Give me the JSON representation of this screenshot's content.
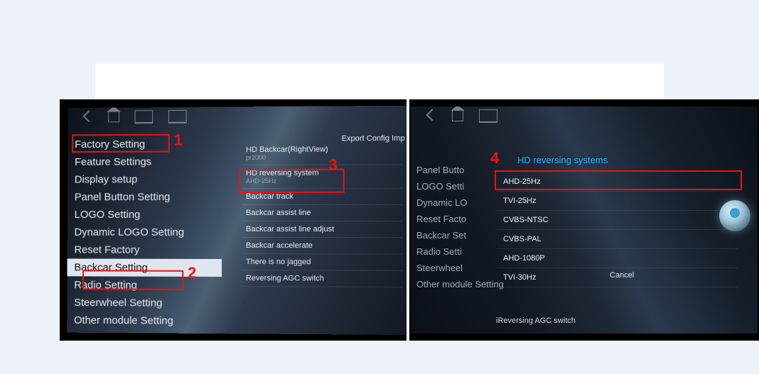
{
  "left": {
    "topRight": "Export Config Imp",
    "menu": [
      "Factory Setting",
      "Feature Settings",
      "Display setup",
      "Panel Button Setting",
      "LOGO Setting",
      "Dynamic LOGO Setting",
      "Reset Factory",
      "Backcar Setting",
      "Radio Setting",
      "Steerwheel Setting",
      "Other module Setting"
    ],
    "selectedIndex": 7,
    "features": [
      {
        "title": "HD Backcar(RightView)",
        "sub": "pr2000"
      },
      {
        "title": "HD reversing system",
        "sub": "AHD-25Hz"
      },
      {
        "title": "Backcar track",
        "sub": ""
      },
      {
        "title": "Backcar assist line",
        "sub": ""
      },
      {
        "title": "Backcar assist line adjust",
        "sub": ""
      },
      {
        "title": "Backcar accelerate",
        "sub": ""
      },
      {
        "title": "There is no jagged",
        "sub": ""
      },
      {
        "title": "Reversing AGC switch",
        "sub": ""
      }
    ]
  },
  "right": {
    "dimMenu": [
      "Panel Butto",
      "LOGO Setti",
      "Dynamic LO",
      "Reset Facto",
      "Backcar Set",
      "Radio Setti",
      "Steerwheel",
      "Other module Setting"
    ],
    "dialogTitle": "HD reversing systems",
    "options": [
      "AHD-25Hz",
      "TVI-25Hz",
      "CVBS-NTSC",
      "CVBS-PAL",
      "AHD-1080P",
      "TVI-30Hz"
    ],
    "cancel": "Cancel",
    "bottomItems": [
      "iReversing AGC switch"
    ]
  },
  "callouts": {
    "n1": "1",
    "n2": "2",
    "n3": "3",
    "n4": "4"
  }
}
